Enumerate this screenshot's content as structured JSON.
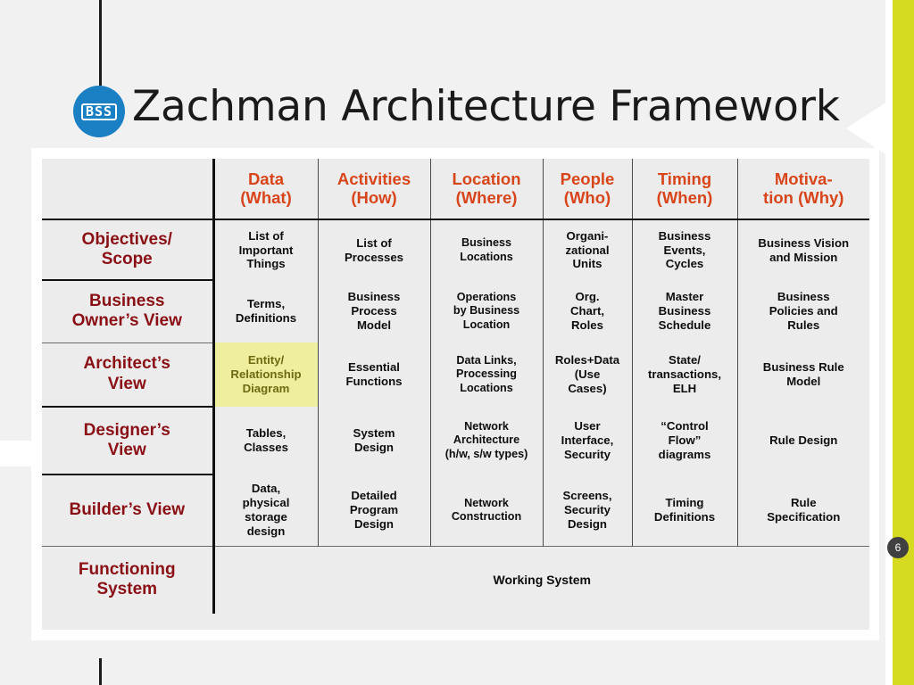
{
  "slide": {
    "title": "Zachman Architecture Framework",
    "page_number": "6",
    "logo_text": "BSS",
    "accent_color": "#d6db22",
    "logo_color": "#1b7fc4",
    "header_color": "#d8451b",
    "row_label_color": "#8a1016",
    "highlight_bg": "#eeee9e",
    "highlight_fg": "#6f6a12"
  },
  "matrix": {
    "corner_label": "",
    "columns": [
      {
        "name": "Data",
        "qualifier": "(What)"
      },
      {
        "name": "Activities",
        "qualifier": "(How)"
      },
      {
        "name": "Location",
        "qualifier": "(Where)"
      },
      {
        "name": "People",
        "qualifier": "(Who)"
      },
      {
        "name": "Timing",
        "qualifier": "(When)"
      },
      {
        "name": "Motiva-",
        "qualifier": "tion (Why)"
      }
    ],
    "rows": [
      {
        "label_line1": "Objectives/",
        "label_line2": "Scope",
        "cells": [
          "List of\nImportant\nThings",
          "List of\nProcesses",
          "Business\nLocations",
          "Organi-\nzational\nUnits",
          "Business\nEvents,\nCycles",
          "Business Vision\nand Mission"
        ],
        "highlight_index": -1
      },
      {
        "label_line1": "Business",
        "label_line2": "Owner’s View",
        "cells": [
          "Terms,\nDefinitions",
          "Business\nProcess\nModel",
          "Operations\nby Business\nLocation",
          "Org.\nChart,\nRoles",
          "Master\nBusiness\nSchedule",
          "Business\nPolicies and\nRules"
        ],
        "highlight_index": -1
      },
      {
        "label_line1": "Architect’s",
        "label_line2": "View",
        "cells": [
          "Entity/\nRelationship\nDiagram",
          "Essential\nFunctions",
          "Data Links,\nProcessing\nLocations",
          "Roles+Data\n(Use\nCases)",
          "State/\ntransactions,\nELH",
          "Business Rule\nModel"
        ],
        "highlight_index": 0
      },
      {
        "label_line1": "Designer’s",
        "label_line2": "View",
        "cells": [
          "Tables,\nClasses",
          "System\nDesign",
          "Network\nArchitecture\n(h/w, s/w types)",
          "User\nInterface,\nSecurity",
          "“Control\nFlow”\ndiagrams",
          "Rule Design"
        ],
        "highlight_index": -1
      },
      {
        "label_line1": "Builder’s View",
        "label_line2": "",
        "cells": [
          "Data,\nphysical\nstorage\ndesign",
          "Detailed\nProgram\nDesign",
          "Network\nConstruction",
          "Screens,\nSecurity\nDesign",
          "Timing\nDefinitions",
          "Rule\nSpecification"
        ],
        "highlight_index": -1
      }
    ],
    "final_row": {
      "label_line1": "Functioning",
      "label_line2": "System",
      "spanning_cell": "Working System"
    }
  }
}
